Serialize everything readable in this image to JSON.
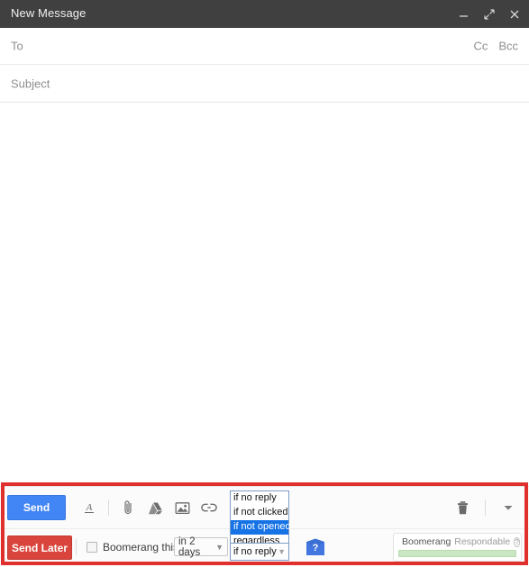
{
  "window": {
    "title": "New Message",
    "controls": [
      {
        "name": "minimize",
        "label": "Minimize"
      },
      {
        "name": "expand",
        "label": "Expand"
      },
      {
        "name": "close",
        "label": "Close"
      }
    ]
  },
  "compose": {
    "to_placeholder": "To",
    "cc_label": "Cc",
    "bcc_label": "Bcc",
    "subject_placeholder": "Subject",
    "body_value": ""
  },
  "toolbar": {
    "send_label": "Send",
    "send_later_label": "Send Later",
    "icons": [
      {
        "name": "format-text-icon",
        "label": "A"
      },
      {
        "name": "attach-file-icon",
        "label": "Attach files"
      },
      {
        "name": "insert-drive-icon",
        "label": "Insert files using Drive"
      },
      {
        "name": "insert-photo-icon",
        "label": "Insert photo"
      },
      {
        "name": "insert-link-icon",
        "label": "Insert link"
      }
    ],
    "discard_label": "Discard draft",
    "more_options_label": "More options"
  },
  "boomerang": {
    "checkbox_label": "Boomerang this",
    "checkbox_checked": false,
    "delay_value": "in 2 days",
    "condition_value": "if no reply",
    "condition_options": [
      "if no reply",
      "if not clicked",
      "if not opened",
      "regardless"
    ],
    "condition_highlighted": "if not opened",
    "help_label": "Boomerang help",
    "respondable": {
      "brand": "Boomerang",
      "name": "Respondable",
      "help_label": "?",
      "score_color": "#c9e7c2"
    }
  },
  "colors": {
    "titlebar": "#404040",
    "send_blue": "#4285f4",
    "send_later_red": "#d9453c",
    "annotation_red": "#e0302e",
    "dropdown_highlight": "#1673e6"
  }
}
